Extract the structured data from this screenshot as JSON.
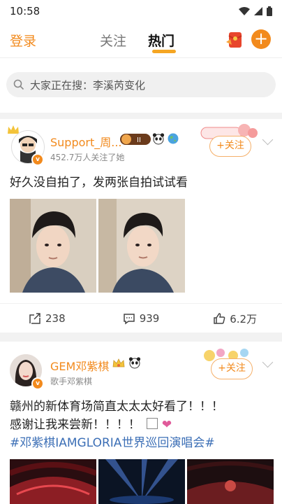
{
  "status": {
    "time": "10:58"
  },
  "nav": {
    "login": "登录",
    "follow_tab": "关注",
    "hot_tab": "热门"
  },
  "search": {
    "placeholder": "大家正在搜：李溪芮变化"
  },
  "posts": [
    {
      "username": "Support_周...",
      "followers": "452.7万人关注了她",
      "follow_label": "+关注",
      "text": "好久没自拍了，发两张自拍试试看",
      "reposts": "238",
      "comments": "939",
      "likes": "6.2万"
    },
    {
      "username": "GEM邓紫棋",
      "verified": "歌手邓紫棋",
      "follow_label": "+关注",
      "text_line1": "赣州的新体育场简直太太太好看了！！！",
      "text_line2": "感谢让我来尝新！！！！",
      "hashtag": "#邓紫棋IAMGLORIA世界巡回演唱会#"
    }
  ],
  "colors": {
    "accent": "#f28a1d",
    "link": "#3c6fb6"
  }
}
